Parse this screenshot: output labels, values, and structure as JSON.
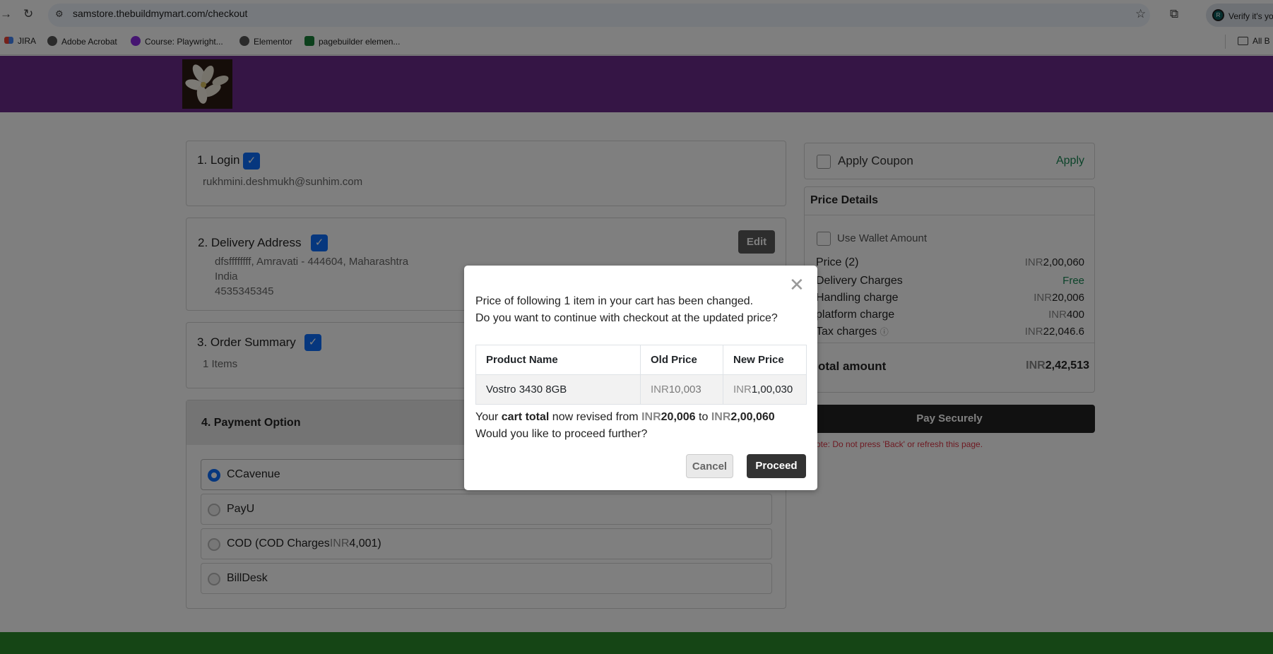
{
  "browser": {
    "url": "samstore.thebuildmymart.com/checkout",
    "verify_label": "Verify it's yo",
    "profile_initial": "R",
    "bookmarks": [
      "JIRA",
      "Adobe Acrobat",
      "Course: Playwright...",
      "Elementor",
      "pagebuilder elemen..."
    ],
    "all_bookmarks": "All B"
  },
  "checkout": {
    "login": {
      "title": "1. Login",
      "email": "rukhmini.deshmukh@sunhim.com"
    },
    "delivery": {
      "title": "2. Delivery Address",
      "edit_label": "Edit",
      "line1": "dfsffffffff, Amravati - 444604, Maharashtra",
      "country": "India",
      "phone": "4535345345"
    },
    "order_summary": {
      "title": "3. Order Summary",
      "items": "1 Items"
    },
    "payment": {
      "title": "4. Payment Option",
      "options": [
        {
          "label": "CCavenue",
          "selected": true
        },
        {
          "label": "PayU",
          "selected": false
        },
        {
          "label_prefix": "COD (COD Charges",
          "currency": "INR",
          "amount": "4,001",
          "label_suffix": ")",
          "selected": false
        },
        {
          "label": "BillDesk",
          "selected": false
        }
      ]
    }
  },
  "sidebar": {
    "coupon_label": "Apply Coupon",
    "coupon_action": "Apply",
    "price_details_title": "Price Details",
    "wallet_label": "Use Wallet Amount",
    "rows": [
      {
        "label": "Price (2)",
        "currency": "INR",
        "value": "2,00,060"
      },
      {
        "label": "Delivery Charges",
        "currency": "",
        "value": "Free"
      },
      {
        "label": "Handling charge",
        "currency": "INR",
        "value": "20,006"
      },
      {
        "label": "platform charge",
        "currency": "INR",
        "value": "400"
      },
      {
        "label": "Tax charges",
        "currency": "INR",
        "value": "22,046.6"
      }
    ],
    "total_label": "otal amount",
    "total_currency": "INR",
    "total_value": "2,42,513",
    "pay_label": "Pay Securely",
    "note": "ote: Do not press 'Back' or refresh this page."
  },
  "modal": {
    "line1": "Price of following 1 item in your cart has been changed.",
    "line2": "Do you want to continue with checkout at the updated price?",
    "table_headers": [
      "Product Name",
      "Old Price",
      "New Price"
    ],
    "product": {
      "name": "Vostro 3430 8GB",
      "old_currency": "INR",
      "old_price": "10,003",
      "new_currency": "INR",
      "new_price": "1,00,030"
    },
    "revised_prefix": "Your ",
    "revised_bold": "cart total",
    "revised_mid": " now revised from ",
    "old_total_currency": "INR",
    "old_total": "20,006",
    "to_word": " to ",
    "new_total_currency": "INR",
    "new_total": "2,00,060",
    "question": "Would you like to proceed further?",
    "cancel_label": "Cancel",
    "proceed_label": "Proceed"
  },
  "colors": {
    "header": "#6a2b8a",
    "accent": "#0d6efd",
    "free": "#198754",
    "note": "#dc3545",
    "footer": "#2a8a2a"
  }
}
